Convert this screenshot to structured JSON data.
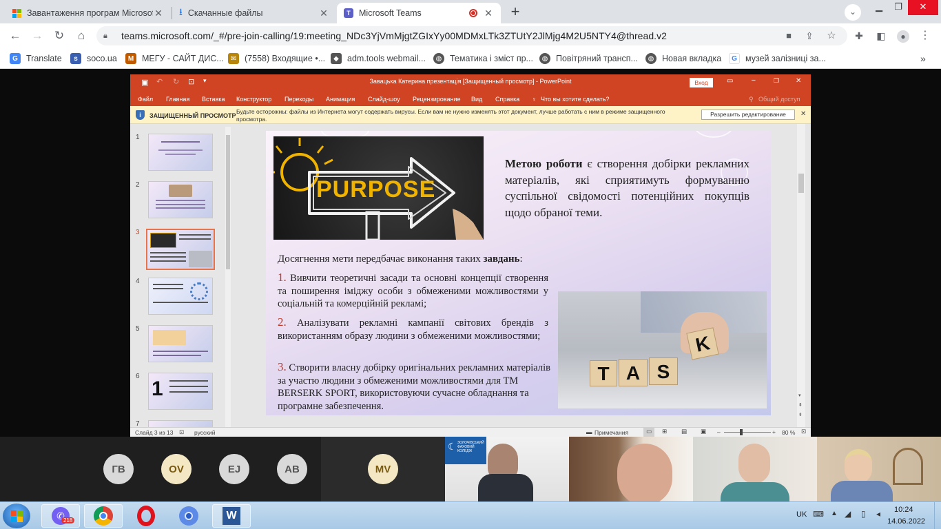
{
  "browser": {
    "tabs": [
      {
        "label": "Завантаження програм Microsoft",
        "icon": "windows-logo-icon"
      },
      {
        "label": "Скачанные файлы",
        "icon": "download-icon"
      },
      {
        "label": "Microsoft Teams",
        "icon": "teams-icon",
        "recording": true
      }
    ],
    "url": "teams.microsoft.com/_#/pre-join-calling/19:meeting_NDc3YjVmMjgtZGIxYy00MDMxLTk3ZTUtY2JlMjg4M2U5NTY4@thread.v2",
    "bookmarks": [
      {
        "label": "Translate",
        "icon": "translate-icon",
        "color": "#4285f4"
      },
      {
        "label": "soco.ua",
        "icon": "soco-icon",
        "color": "#3b5fb0"
      },
      {
        "label": "МЕГУ - САЙТ ДИС...",
        "icon": "megu-icon",
        "color": "#c05a00"
      },
      {
        "label": "(7558) Входящие •...",
        "icon": "mail-icon",
        "color": "#7a5a00"
      },
      {
        "label": "adm.tools webmail...",
        "icon": "adm-tools-icon",
        "color": "#555"
      },
      {
        "label": "Тематика і зміст пр...",
        "icon": "globe-icon",
        "color": "#555"
      },
      {
        "label": "Повітряний трансп...",
        "icon": "globe-icon",
        "color": "#555"
      },
      {
        "label": "Новая вкладка",
        "icon": "globe-icon",
        "color": "#555"
      },
      {
        "label": "музей залізниці за...",
        "icon": "google-icon",
        "color": "#4285f4"
      }
    ]
  },
  "ppt": {
    "window_title": "Завацька Катерина презентація [Защищенный просмотр] - PowerPoint",
    "signin": "Вход",
    "menu": [
      "Файл",
      "Главная",
      "Вставка",
      "Конструктор",
      "Переходы",
      "Анимация",
      "Слайд-шоу",
      "Рецензирование",
      "Вид",
      "Справка"
    ],
    "tell_me": "Что вы хотите сделать?",
    "share": "Общий доступ",
    "protected_title": "ЗАЩИЩЕННЫЙ ПРОСМОТР",
    "protected_msg": "Будьте осторожны: файлы из Интернета могут содержать вирусы. Если вам не нужно изменять этот документ, лучше работать с ним в режиме защищенного просмотра.",
    "enable_editing": "Разрешить редактирование",
    "thumbs": [
      "1",
      "2",
      "3",
      "4",
      "5",
      "6",
      "7"
    ],
    "selected_slide": 3,
    "status_slide": "Слайд 3 из 13",
    "status_lang": "русский",
    "status_notes": "Примечания",
    "zoom": "80 %"
  },
  "slide": {
    "purpose_img_text": "PURPOSE",
    "goal_bold": "Метою роботи",
    "goal_rest": " є створення добірки рекламних матеріалів, які сприятимуть формуванню суспільної свідомості потенційних покупців щодо обраної теми.",
    "tasks_intro_a": "Досягнення мети передбачає виконання таких ",
    "tasks_intro_bold": "завдань",
    "tasks_intro_end": ":",
    "tasks": [
      {
        "n": "1.",
        "text": " Вивчити теоретичні засади та основні концепції створення та поширення іміджу особи з обмеженими можливостями у соціальній та комерційній рекламі;"
      },
      {
        "n": "2.",
        "text": " Аналізувати рекламні кампанії світових брендів з використанням образу людини з обмеженими можливостями;"
      },
      {
        "n": "3.",
        "text": " Створити власну добірку оригінальних рекламних матеріалів за участю людини з обмеженими можливостями для ТМ BERSERK SPORT, використовуючи сучасне обладнання та програмне забезпечення."
      }
    ],
    "task_blocks": [
      "T",
      "A",
      "S",
      "K"
    ],
    "accent": "#c0392b"
  },
  "participants": {
    "avatars": [
      {
        "initials": "ГВ",
        "bg": "#d9d9d9",
        "fg": "#555"
      },
      {
        "initials": "OV",
        "bg": "#f4e8c4",
        "fg": "#7a5a10"
      },
      {
        "initials": "EJ",
        "bg": "#d9d9d9",
        "fg": "#555"
      },
      {
        "initials": "AB",
        "bg": "#d9d9d9",
        "fg": "#555"
      },
      {
        "initials": "MV",
        "bg": "#f4e8c4",
        "fg": "#7a5a10"
      }
    ],
    "logo_text": "ЗОЛОЧІВСЬКИЙ ФАХОВИЙ КОЛЕДЖ"
  },
  "taskbar": {
    "viber_badge": "218",
    "lang": "UK",
    "time": "10:24",
    "date": "14.06.2022"
  }
}
